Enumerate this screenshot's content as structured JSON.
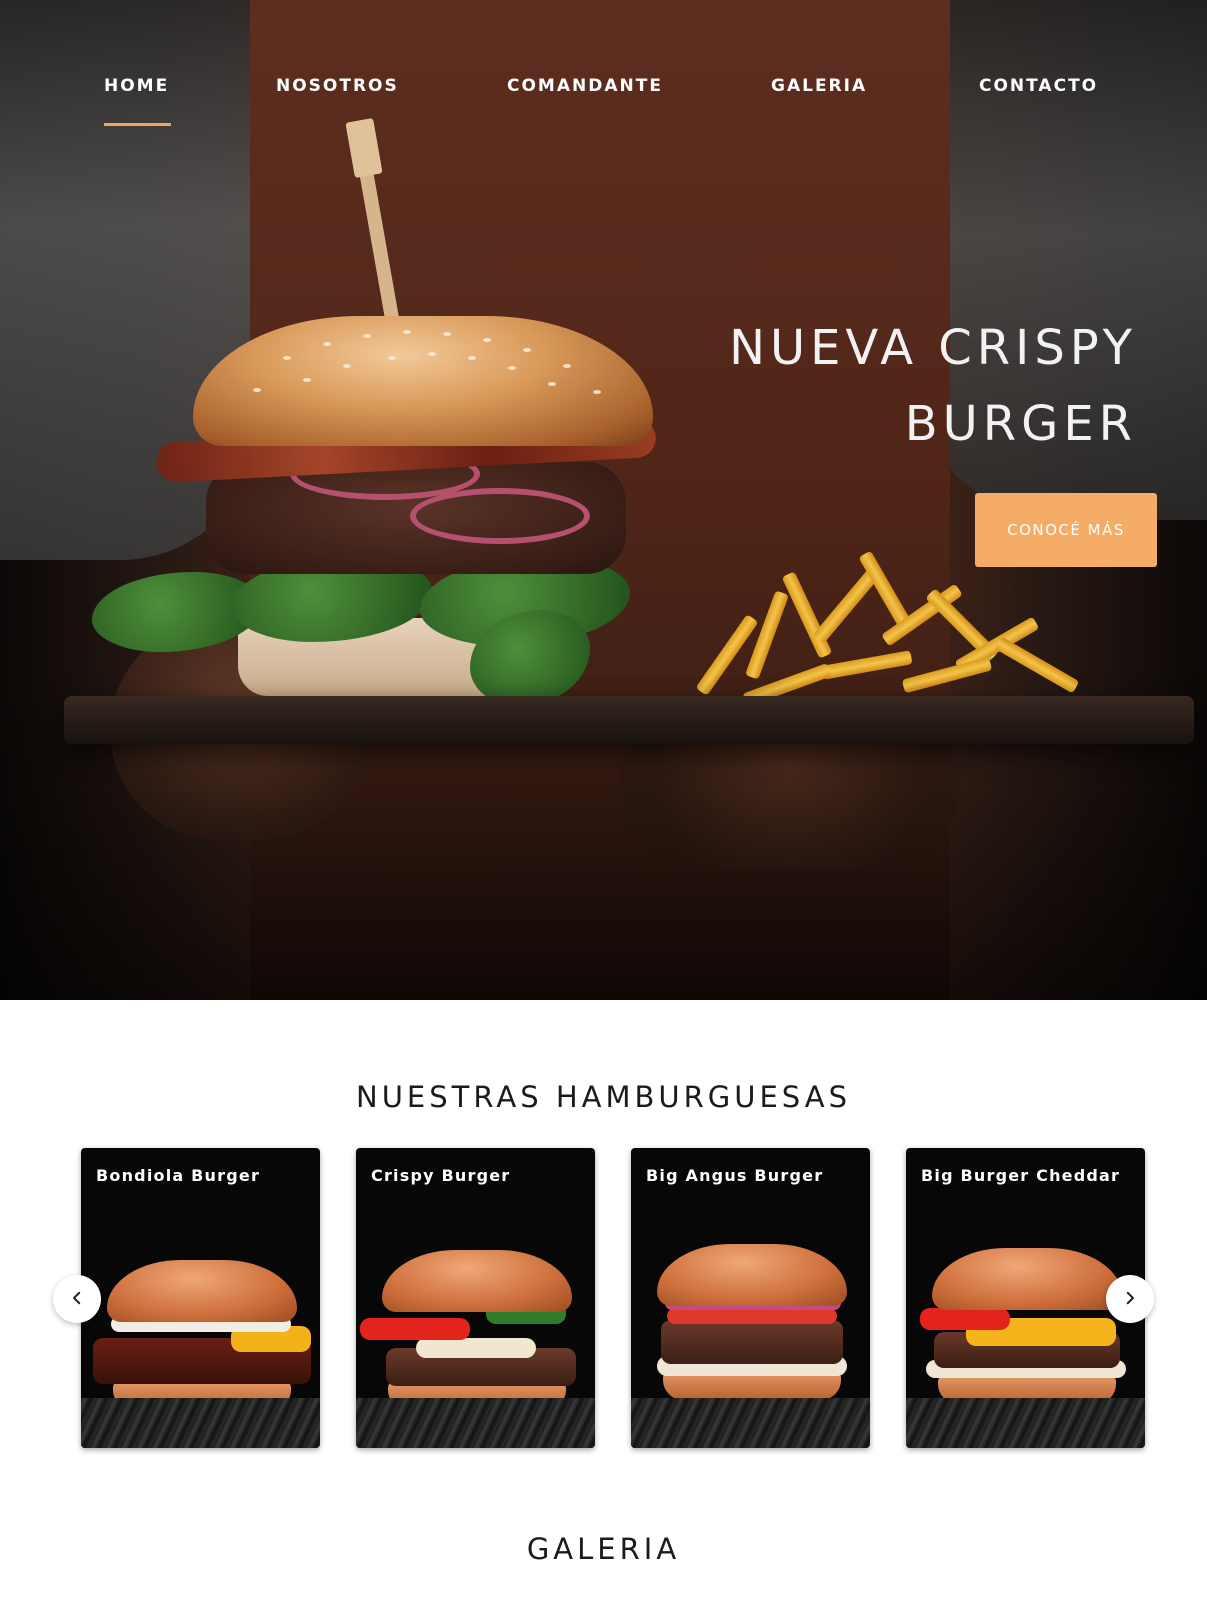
{
  "nav": {
    "items": [
      {
        "label": "HOME",
        "active": true
      },
      {
        "label": "NOSOTROS",
        "active": false
      },
      {
        "label": "COMANDANTE",
        "active": false
      },
      {
        "label": "GALERIA",
        "active": false
      },
      {
        "label": "CONTACTO",
        "active": false
      }
    ]
  },
  "hero": {
    "title_line1": "NUEVA CRISPY",
    "title_line2": "BURGER",
    "cta_label": "CONOCÉ MÁS"
  },
  "burgers": {
    "heading": "NUESTRAS HAMBURGUESAS",
    "cards": [
      {
        "title": "Bondiola Burger"
      },
      {
        "title": "Crispy Burger"
      },
      {
        "title": "Big Angus Burger"
      },
      {
        "title": "Big Burger Cheddar"
      }
    ],
    "prev_icon": "chevron-left-icon",
    "next_icon": "chevron-right-icon"
  },
  "gallery": {
    "heading": "GALERIA"
  },
  "colors": {
    "accent": "#f5ac66",
    "nav_text": "#ffffff",
    "heading_text": "#1b1b1b"
  }
}
